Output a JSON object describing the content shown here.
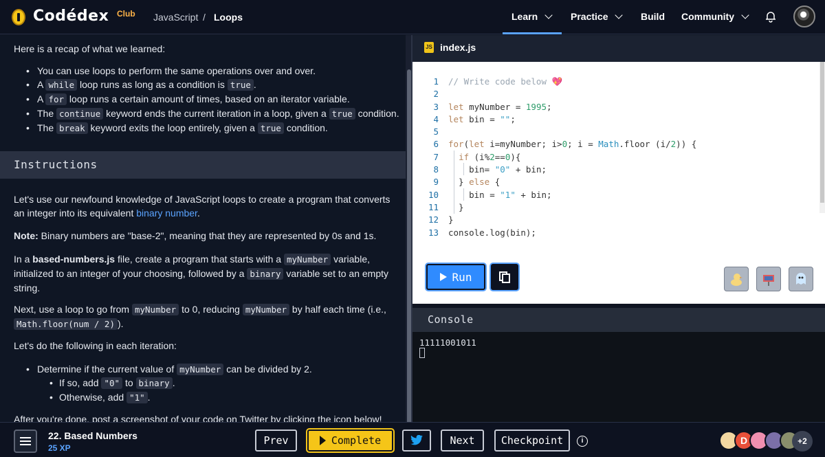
{
  "nav": {
    "brand": "Codédex",
    "club": "Club",
    "breadcrumb": [
      "JavaScript",
      "/",
      "Loops"
    ],
    "items": [
      {
        "label": "Learn",
        "has_dropdown": true,
        "active": true
      },
      {
        "label": "Practice",
        "has_dropdown": true
      },
      {
        "label": "Build",
        "has_dropdown": false
      },
      {
        "label": "Community",
        "has_dropdown": true
      }
    ],
    "icons": [
      "bell-icon",
      "user-avatar"
    ]
  },
  "lesson": {
    "recap_intro": "Here is a recap of what we learned:",
    "recap": [
      {
        "parts": [
          {
            "t": "You can use loops to perform the same operations over and over."
          }
        ]
      },
      {
        "parts": [
          {
            "t": "A "
          },
          {
            "c": "while"
          },
          {
            "t": " loop runs as long as a condition is "
          },
          {
            "c": "true"
          },
          {
            "t": "."
          }
        ]
      },
      {
        "parts": [
          {
            "t": "A "
          },
          {
            "c": "for"
          },
          {
            "t": " loop runs a certain amount of times, based on an iterator variable."
          }
        ]
      },
      {
        "parts": [
          {
            "t": "The "
          },
          {
            "c": "continue"
          },
          {
            "t": " keyword ends the current iteration in a loop, given a "
          },
          {
            "c": "true"
          },
          {
            "t": " condition."
          }
        ]
      },
      {
        "parts": [
          {
            "t": "The "
          },
          {
            "c": "break"
          },
          {
            "t": " keyword exits the loop entirely, given a "
          },
          {
            "c": "true"
          },
          {
            "t": " condition."
          }
        ]
      }
    ],
    "instructions_heading": "Instructions",
    "p1_a": "Let's use our newfound knowledge of JavaScript loops to create a program that converts an integer into its equivalent ",
    "p1_link": "binary number",
    "p1_b": ".",
    "note_label": "Note:",
    "note_text": " Binary numbers are \"base-2\", meaning that they are represented by 0s and 1s.",
    "p3_a": "In a ",
    "p3_file": "based-numbers.js",
    "p3_b": " file, create a program that starts with a ",
    "p3_c1": "myNumber",
    "p3_c": " variable, initialized to an integer of your choosing, followed by a ",
    "p3_c2": "binary",
    "p3_d": " variable set to an empty string.",
    "p4_a": "Next, use a loop to go from ",
    "p4_c1": "myNumber",
    "p4_b": " to 0, reducing ",
    "p4_c2": "myNumber",
    "p4_c": " by half each time (i.e., ",
    "p4_c3": "Math.floor(num / 2)",
    "p4_d": ").",
    "p5": "Let's do the following in each iteration:",
    "b1_a": "Determine if the current value of ",
    "b1_c": "myNumber",
    "b1_b": " can be divided by 2.",
    "s1_a": "If so, add ",
    "s1_c1": "\"0\"",
    "s1_b": " to ",
    "s1_c2": "binary",
    "s1_d": ".",
    "s2_a": "Otherwise, add ",
    "s2_c": "\"1\"",
    "s2_b": ".",
    "p6": "After you're done, post a screenshot of your code on Twitter by clicking the icon below!"
  },
  "editor": {
    "filename": "index.js",
    "js_badge": "JS",
    "lines": [
      "// Write code below 💖",
      "",
      "let myNumber = 1995;",
      "let bin = \"\";",
      "",
      "for(let i=myNumber; i>0; i = Math.floor (i/2)) {",
      "  if (i%2==0){",
      "    bin= \"0\" + bin;",
      "  } else {",
      "    bin = \"1\" + bin;",
      "  }",
      "}",
      "console.log(bin);"
    ],
    "run_label": "Run",
    "pets": [
      "duck-icon",
      "mailbox-icon",
      "ghost-icon"
    ]
  },
  "console": {
    "title": "Console",
    "output": "11111001011"
  },
  "bottom": {
    "lesson_title": "22. Based Numbers",
    "xp": "25 XP",
    "prev": "Prev",
    "complete": "Complete",
    "next": "Next",
    "checkpoint": "Checkpoint",
    "info": "i",
    "avatars": [
      {
        "label": "",
        "color": "#f2d7a1"
      },
      {
        "label": "D",
        "color": "#e8503a"
      },
      {
        "label": "",
        "color": "#f08fb0"
      },
      {
        "label": "",
        "color": "#7b6fa8"
      },
      {
        "label": "",
        "color": "#8a8f6c"
      }
    ],
    "more": "+2"
  },
  "colors": {
    "accent": "#2f8bff",
    "complete": "#f5c518",
    "link": "#5aa3ff"
  }
}
